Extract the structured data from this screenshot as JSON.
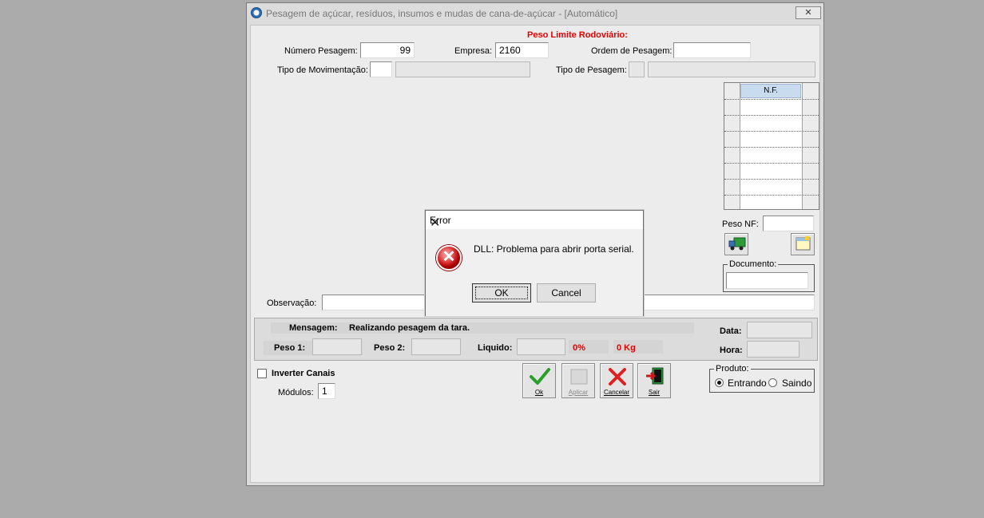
{
  "window": {
    "title": "Pesagem de açúcar, resíduos, insumos e mudas de cana-de-açúcar - [Automático]",
    "close_glyph": "✕"
  },
  "form": {
    "peso_limite_label": "Peso Limite Rodoviário:",
    "numero_pesagem_label": "Número Pesagem:",
    "numero_pesagem_value": "99",
    "empresa_label": "Empresa:",
    "empresa_value": "2160",
    "ordem_pesagem_label": "Ordem de Pesagem:",
    "ordem_pesagem_value": "",
    "tipo_movimentacao_label": "Tipo de Movimentação:",
    "tipo_movimentacao_code": "",
    "tipo_movimentacao_desc": "",
    "tipo_pesagem_label": "Tipo de Pesagem:",
    "tipo_pesagem_code": "",
    "tipo_pesagem_desc": "",
    "nf_header": "N.F.",
    "peso_nf_label": "Peso NF:",
    "peso_nf_value": "",
    "documento_label": "Documento:",
    "documento_value": "",
    "observacao_label": "Observação:",
    "observacao_value": ""
  },
  "status_panel": {
    "mensagem_label": "Mensagem:",
    "mensagem_value": "Realizando pesagem da tara.",
    "peso1_label": "Peso 1:",
    "peso1_value": "",
    "peso2_label": "Peso 2:",
    "peso2_value": "",
    "liquido_label": "Liquido:",
    "liquido_value": "",
    "percent": "0%",
    "kg": "0 Kg",
    "data_label": "Data:",
    "data_value": "",
    "hora_label": "Hora:",
    "hora_value": ""
  },
  "options": {
    "inverter_canais_label": "Inverter Canais",
    "inverter_canais_checked": false,
    "modulos_label": "Módulos:",
    "modulos_value": "1",
    "produto_label": "Produto:",
    "entrando_label": "Entrando",
    "saindo_label": "Saindo",
    "selected": "Entrando"
  },
  "toolbar": {
    "ok_label": "Ok",
    "aplicar_label": "Aplicar",
    "cancelar_label": "Cancelar",
    "sair_label": "Sair"
  },
  "dialog": {
    "title": "Error",
    "close_glyph": "✕",
    "message": "DLL: Problema para abrir porta serial.",
    "ok_label": "OK",
    "cancel_label": "Cancel",
    "icon": "error-icon"
  },
  "colors": {
    "accent_red": "#e60000",
    "grid_header": "#c9dbee",
    "desktop": "#ababab"
  }
}
